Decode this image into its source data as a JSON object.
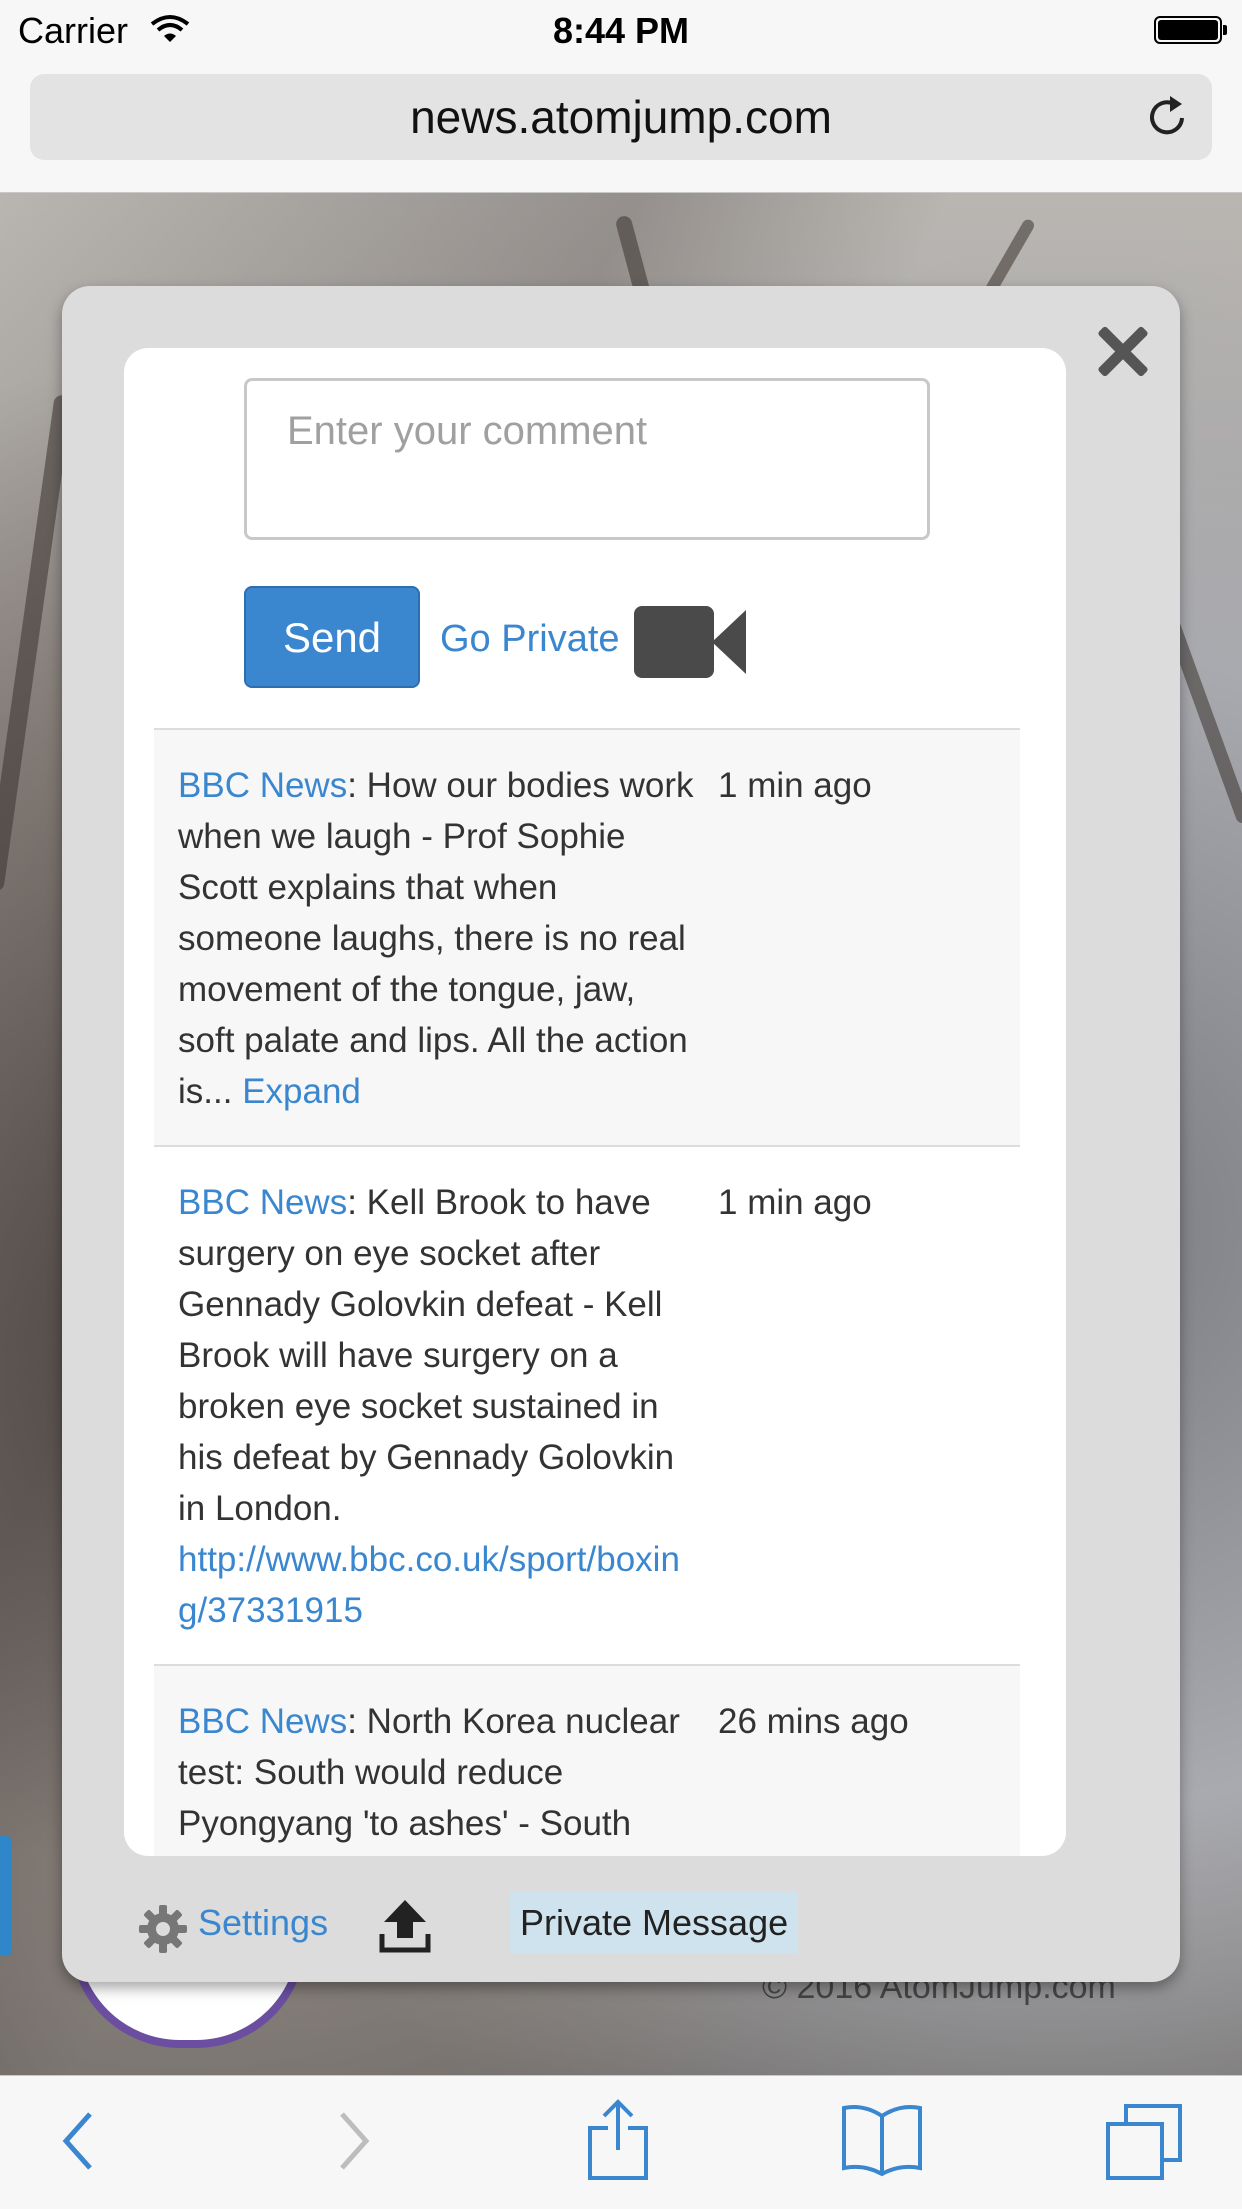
{
  "status_bar": {
    "carrier": "Carrier",
    "time": "8:44 PM"
  },
  "browser": {
    "url": "news.atomjump.com"
  },
  "modal": {
    "comment_placeholder": "Enter your comment",
    "send_label": "Send",
    "go_private_label": "Go Private",
    "messages": [
      {
        "source": "BBC News",
        "text": ": How our bodies work when we laugh - Prof Sophie Scott explains that when someone laughs, there is no real movement of the tongue, jaw, soft palate and lips. All the action is... ",
        "expand": "Expand",
        "time": "1 min ago"
      },
      {
        "source": "BBC News",
        "text": ": Kell Brook to have surgery on eye socket after Gennady Golovkin defeat - Kell Brook will have surgery on a broken eye socket sustained in his defeat by Gennady Golovkin in London.",
        "link": "http://www.bbc.co.uk/sport/boxing/37331915",
        "time": "1 min ago"
      },
      {
        "source": "BBC News",
        "text": ": North Korea nuclear test: South would reduce Pyongyang 'to ashes' - South Korea has made a threat",
        "time": "26 mins ago"
      }
    ],
    "settings_label": "Settings",
    "private_message_label": "Private Message"
  },
  "page": {
    "copyright": "© 2016 AtomJump.com"
  },
  "icons": {
    "wifi": "wifi-icon",
    "battery": "battery-icon",
    "reload": "reload-icon",
    "close": "close-icon",
    "video": "video-camera-icon",
    "gear": "gear-icon",
    "upload": "upload-icon",
    "back": "back-icon",
    "forward": "forward-icon",
    "share": "share-icon",
    "bookmarks": "bookmarks-icon",
    "tabs": "tabs-icon"
  },
  "colors": {
    "accent": "#3a87cf",
    "private_bg": "#cfe3ee"
  }
}
